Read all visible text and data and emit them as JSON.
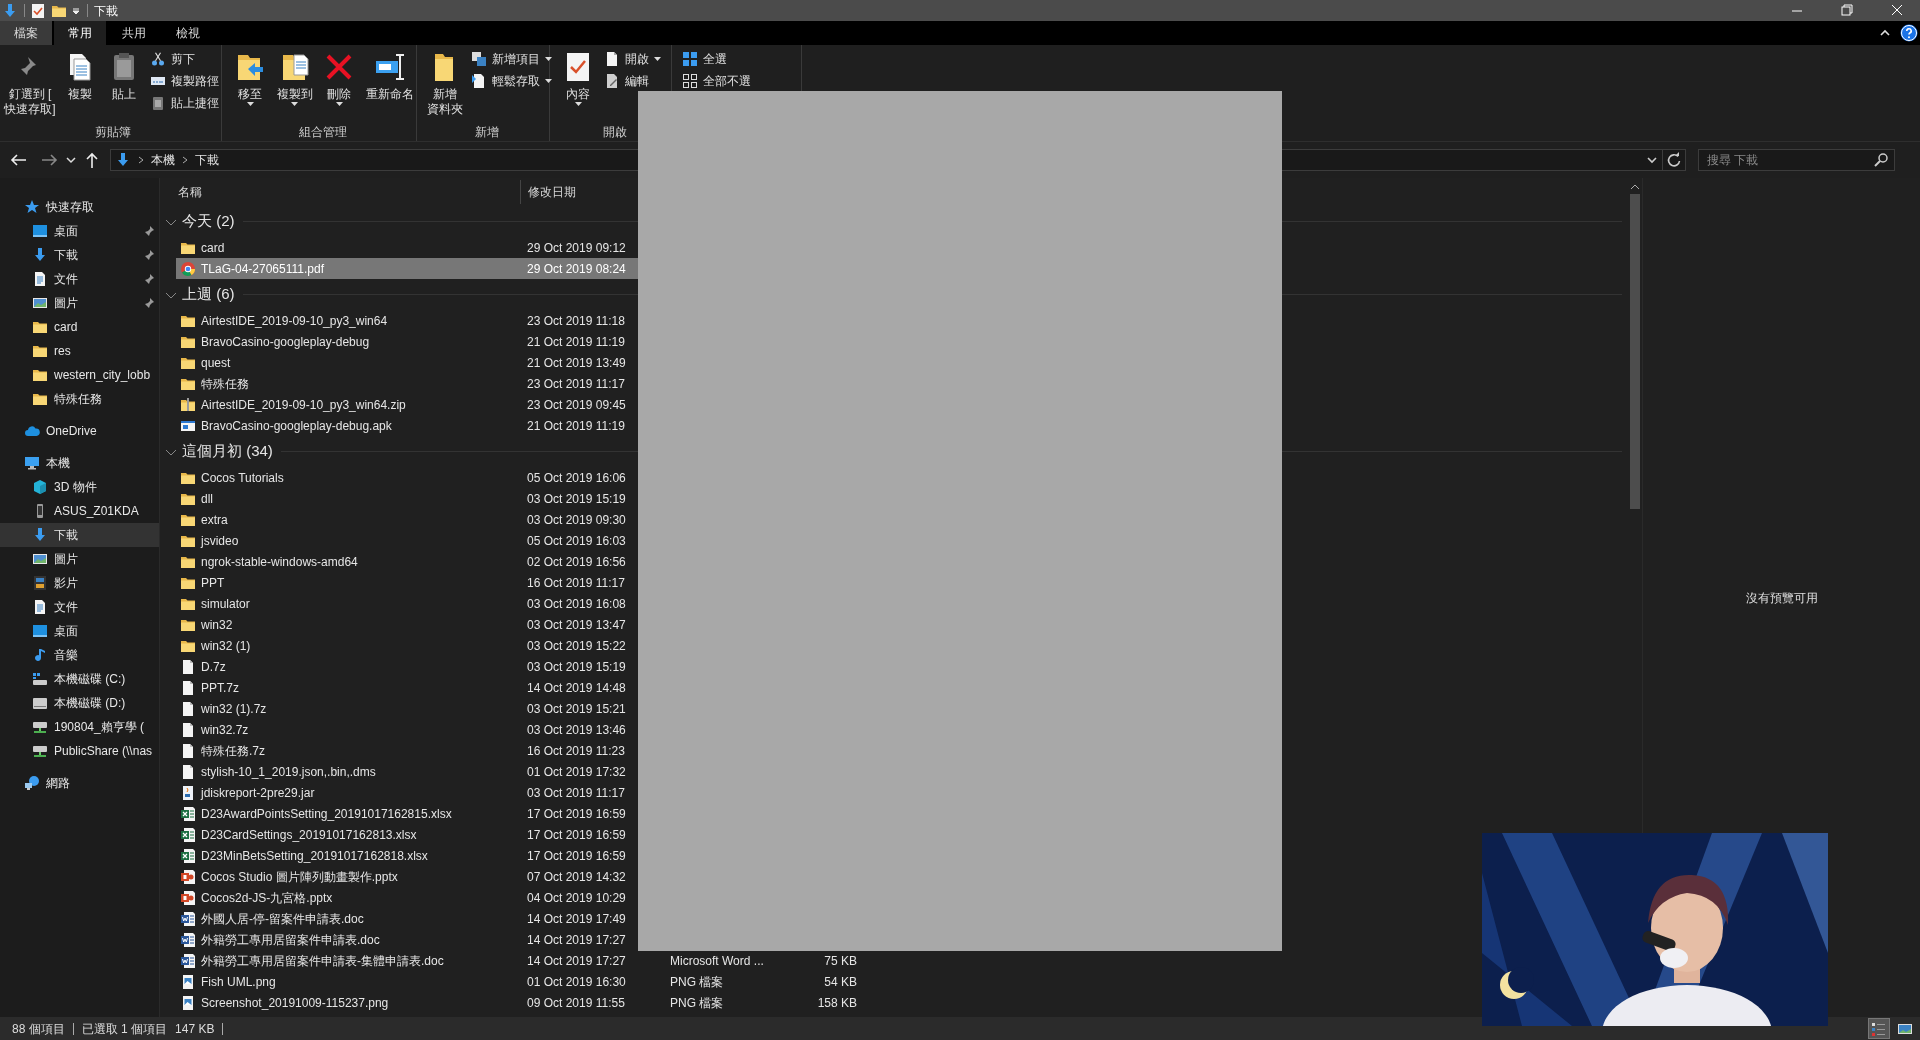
{
  "window": {
    "title": "下載"
  },
  "ribbon_tabs": [
    {
      "label": "檔案",
      "kind": "file",
      "selected": false
    },
    {
      "label": "常用",
      "kind": "tab",
      "selected": true
    },
    {
      "label": "共用",
      "kind": "tab",
      "selected": false
    },
    {
      "label": "檢視",
      "kind": "tab",
      "selected": false
    }
  ],
  "ribbon_groups": [
    {
      "label": "剪貼簿",
      "items": [
        {
          "kind": "large",
          "lines": [
            "釘選到 [",
            "快速存取]"
          ],
          "dropdown": false
        },
        {
          "kind": "large",
          "lines": [
            "複製"
          ],
          "dropdown": false
        },
        {
          "kind": "large",
          "lines": [
            "貼上"
          ],
          "dropdown": false
        },
        {
          "kind": "small",
          "label": "剪下",
          "dropdown": false
        },
        {
          "kind": "small",
          "label": "複製路徑",
          "dropdown": false
        },
        {
          "kind": "small",
          "label": "貼上捷徑",
          "dropdown": false
        }
      ]
    },
    {
      "label": "組合管理",
      "items": [
        {
          "kind": "large",
          "lines": [
            "移至"
          ],
          "dropdown": true
        },
        {
          "kind": "large",
          "lines": [
            "複製到"
          ],
          "dropdown": true
        },
        {
          "kind": "large",
          "lines": [
            "刪除"
          ],
          "dropdown": true
        },
        {
          "kind": "large",
          "lines": [
            "重新命名"
          ],
          "dropdown": false
        }
      ]
    },
    {
      "label": "新增",
      "items": [
        {
          "kind": "large",
          "lines": [
            "新增",
            "資料夾"
          ],
          "dropdown": false
        },
        {
          "kind": "small",
          "label": "新增項目",
          "dropdown": true
        },
        {
          "kind": "small",
          "label": "輕鬆存取",
          "dropdown": true
        }
      ]
    },
    {
      "label": "開啟",
      "items": [
        {
          "kind": "large",
          "lines": [
            "內容"
          ],
          "dropdown": true
        },
        {
          "kind": "small",
          "label": "開啟",
          "dropdown": true
        },
        {
          "kind": "small",
          "label": "編輯",
          "dropdown": false
        }
      ]
    },
    {
      "items": [
        {
          "kind": "small",
          "label": "全選",
          "dropdown": false
        },
        {
          "kind": "small",
          "label": "全部不選",
          "dropdown": false
        }
      ]
    }
  ],
  "address": {
    "path": [
      "本機",
      "下載"
    ]
  },
  "search": {
    "placeholder": "搜尋 下載"
  },
  "navigation": [
    {
      "label": "快速存取",
      "kind": "star",
      "selected": false,
      "children": [
        {
          "label": "桌面",
          "kind": "desktop",
          "pinned": true,
          "selected": false
        },
        {
          "label": "下載",
          "kind": "download",
          "pinned": true,
          "selected": false
        },
        {
          "label": "文件",
          "kind": "document",
          "pinned": true,
          "selected": false
        },
        {
          "label": "圖片",
          "kind": "picture",
          "pinned": true,
          "selected": false
        },
        {
          "label": "card",
          "kind": "folder",
          "pinned": false,
          "selected": false
        },
        {
          "label": "res",
          "kind": "folder",
          "pinned": false,
          "selected": false
        },
        {
          "label": "western_city_lobb",
          "kind": "folder",
          "pinned": false,
          "selected": false
        },
        {
          "label": "特殊任務",
          "kind": "folder",
          "pinned": false,
          "selected": false
        }
      ]
    },
    {
      "label": "OneDrive",
      "kind": "cloud",
      "selected": false
    },
    {
      "label": "本機",
      "kind": "computer",
      "selected": false,
      "children": [
        {
          "label": "3D 物件",
          "kind": "cube",
          "selected": false
        },
        {
          "label": "ASUS_Z01KDA",
          "kind": "phone",
          "selected": false
        },
        {
          "label": "下載",
          "kind": "download",
          "selected": true
        },
        {
          "label": "圖片",
          "kind": "picture",
          "selected": false
        },
        {
          "label": "影片",
          "kind": "film",
          "selected": false
        },
        {
          "label": "文件",
          "kind": "document",
          "selected": false
        },
        {
          "label": "桌面",
          "kind": "desktop",
          "selected": false
        },
        {
          "label": "音樂",
          "kind": "music",
          "selected": false
        },
        {
          "label": "本機磁碟 (C:)",
          "kind": "system_drive",
          "selected": false
        },
        {
          "label": "本機磁碟 (D:)",
          "kind": "drive",
          "selected": false
        },
        {
          "label": "190804_賴亨學 (",
          "kind": "network_drive",
          "selected": false
        },
        {
          "label": "PublicShare (\\\\nas",
          "kind": "network_drive",
          "selected": false
        }
      ]
    },
    {
      "label": "網路",
      "kind": "network",
      "selected": false
    }
  ],
  "columns": [
    {
      "label": "名稱"
    },
    {
      "label": "修改日期"
    }
  ],
  "file_groups": [
    {
      "label": "今天 (2)",
      "expanded": true,
      "rows": [
        {
          "name": "card",
          "date": "29 Oct 2019 09:12",
          "kind": "folder",
          "selected": false
        },
        {
          "name": "TLaG-04-27065111.pdf",
          "date": "29 Oct 2019 08:24",
          "kind": "pdf",
          "selected": true
        }
      ]
    },
    {
      "label": "上週 (6)",
      "expanded": true,
      "rows": [
        {
          "name": "AirtestIDE_2019-09-10_py3_win64",
          "date": "23 Oct 2019 11:18",
          "kind": "folder",
          "selected": false
        },
        {
          "name": "BravoCasino-googleplay-debug",
          "date": "21 Oct 2019 11:19",
          "kind": "folder",
          "selected": false
        },
        {
          "name": "quest",
          "date": "21 Oct 2019 13:49",
          "kind": "folder",
          "selected": false
        },
        {
          "name": "特殊任務",
          "date": "23 Oct 2019 11:17",
          "kind": "folder",
          "selected": false
        },
        {
          "name": "AirtestIDE_2019-09-10_py3_win64.zip",
          "date": "23 Oct 2019 09:45",
          "kind": "zip",
          "selected": false
        },
        {
          "name": "BravoCasino-googleplay-debug.apk",
          "date": "21 Oct 2019 11:19",
          "kind": "apk",
          "selected": false
        }
      ]
    },
    {
      "label": "這個月初 (34)",
      "expanded": true,
      "rows": [
        {
          "name": "Cocos Tutorials",
          "date": "05 Oct 2019 16:06",
          "kind": "folder",
          "selected": false
        },
        {
          "name": "dll",
          "date": "03 Oct 2019 15:19",
          "kind": "folder",
          "selected": false
        },
        {
          "name": "extra",
          "date": "03 Oct 2019 09:30",
          "kind": "folder",
          "selected": false
        },
        {
          "name": "jsvideo",
          "date": "05 Oct 2019 16:03",
          "kind": "folder",
          "selected": false
        },
        {
          "name": "ngrok-stable-windows-amd64",
          "date": "02 Oct 2019 16:56",
          "kind": "folder",
          "selected": false
        },
        {
          "name": "PPT",
          "date": "16 Oct 2019 11:17",
          "kind": "folder",
          "selected": false
        },
        {
          "name": "simulator",
          "date": "03 Oct 2019 16:08",
          "kind": "folder",
          "selected": false
        },
        {
          "name": "win32",
          "date": "03 Oct 2019 13:47",
          "kind": "folder",
          "selected": false
        },
        {
          "name": "win32 (1)",
          "date": "03 Oct 2019 15:22",
          "kind": "folder",
          "selected": false
        },
        {
          "name": "D.7z",
          "date": "03 Oct 2019 15:19",
          "kind": "file",
          "selected": false
        },
        {
          "name": "PPT.7z",
          "date": "14 Oct 2019 14:48",
          "kind": "file",
          "selected": false
        },
        {
          "name": "win32 (1).7z",
          "date": "03 Oct 2019 15:21",
          "kind": "file",
          "selected": false
        },
        {
          "name": "win32.7z",
          "date": "03 Oct 2019 13:46",
          "kind": "file",
          "selected": false
        },
        {
          "name": "特殊任務.7z",
          "date": "16 Oct 2019 11:23",
          "kind": "file",
          "selected": false
        },
        {
          "name": "stylish-10_1_2019.json,.bin,.dms",
          "date": "01 Oct 2019 17:32",
          "kind": "file",
          "selected": false
        },
        {
          "name": "jdiskreport-2pre29.jar",
          "date": "03 Oct 2019 11:17",
          "kind": "jar",
          "selected": false
        },
        {
          "name": "D23AwardPointsSetting_20191017162815.xlsx",
          "date": "17 Oct 2019 16:59",
          "kind": "xlsx",
          "selected": false
        },
        {
          "name": "D23CardSettings_20191017162813.xlsx",
          "date": "17 Oct 2019 16:59",
          "kind": "xlsx",
          "selected": false
        },
        {
          "name": "D23MinBetsSetting_20191017162818.xlsx",
          "date": "17 Oct 2019 16:59",
          "kind": "xlsx",
          "selected": false
        },
        {
          "name": "Cocos Studio 圖片陣列動畫製作.pptx",
          "date": "07 Oct 2019 14:32",
          "kind": "pptx",
          "selected": false
        },
        {
          "name": "Cocos2d-JS-九宮格.pptx",
          "date": "04 Oct 2019 10:29",
          "kind": "pptx",
          "selected": false
        },
        {
          "name": "外國人居-停-留案件申請表.doc",
          "date": "14 Oct 2019 17:49",
          "kind": "doc",
          "selected": false
        },
        {
          "name": "外籍勞工專用居留案件申請表.doc",
          "date": "14 Oct 2019 17:27",
          "kind": "doc",
          "selected": false
        },
        {
          "name": "外籍勞工專用居留案件申請表-集體申請表.doc",
          "date": "14 Oct 2019 17:27",
          "kind": "doc",
          "type": "Microsoft Word ...",
          "size": "75 KB",
          "selected": false
        },
        {
          "name": "Fish UML.png",
          "date": "01 Oct 2019 16:30",
          "kind": "png",
          "type": "PNG 檔案",
          "size": "54 KB",
          "selected": false
        },
        {
          "name": "Screenshot_20191009-115237.png",
          "date": "09 Oct 2019 11:55",
          "kind": "png",
          "type": "PNG 檔案",
          "size": "158 KB",
          "selected": false
        }
      ]
    }
  ],
  "preview": {
    "message": "沒有預覽可用"
  },
  "status_bar": {
    "item_count": "88 個項目",
    "selection": "已選取 1 個項目",
    "size": "147 KB"
  },
  "view_buttons": [
    {
      "kind": "details",
      "selected": true
    },
    {
      "kind": "large_icons",
      "selected": false
    }
  ]
}
